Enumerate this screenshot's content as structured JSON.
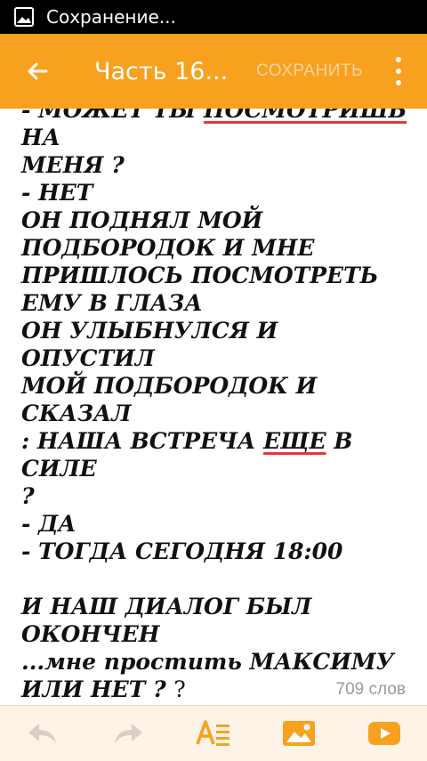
{
  "status_bar": {
    "text": "Сохранение...",
    "icon": "image-icon"
  },
  "app_bar": {
    "title": "Часть 16...",
    "save_label": "СОХРАНИТЬ",
    "back_icon": "arrow-left-icon",
    "menu_icon": "more-vertical-icon"
  },
  "editor": {
    "lines": [
      {
        "parts": [
          {
            "t": "- МОЖЕТ ТЫ "
          },
          {
            "t": "ПОСМОТРИШЬ",
            "err": true
          },
          {
            "t": " НА"
          }
        ]
      },
      {
        "parts": [
          {
            "t": "МЕНЯ ?"
          }
        ]
      },
      {
        "parts": [
          {
            "t": "- НЕТ"
          }
        ]
      },
      {
        "parts": [
          {
            "t": "ОН ПОДНЯЛ МОЙ"
          }
        ]
      },
      {
        "parts": [
          {
            "t": "ПОДБОРОДОК И МНЕ"
          }
        ]
      },
      {
        "parts": [
          {
            "t": "ПРИШЛОСЬ ПОСМОТРЕТЬ"
          }
        ]
      },
      {
        "parts": [
          {
            "t": "ЕМУ В ГЛАЗА"
          }
        ]
      },
      {
        "parts": [
          {
            "t": "ОН УЛЫБНУЛСЯ И ОПУСТИЛ"
          }
        ]
      },
      {
        "parts": [
          {
            "t": "МОЙ ПОДБОРОДОК И СКАЗАЛ"
          }
        ]
      },
      {
        "parts": [
          {
            "t": ": НАША ВСТРЕЧА "
          },
          {
            "t": "ЕЩЕ",
            "err": true
          },
          {
            "t": " В СИЛЕ"
          }
        ]
      },
      {
        "parts": [
          {
            "t": "?"
          }
        ]
      },
      {
        "parts": [
          {
            "t": "- ДА"
          }
        ]
      },
      {
        "parts": [
          {
            "t": "- ТОГДА СЕГОДНЯ 18:00"
          }
        ]
      },
      {
        "parts": [
          {
            "t": ""
          }
        ]
      },
      {
        "parts": [
          {
            "t": "И НАШ ДИАЛОГ БЫЛ"
          }
        ]
      },
      {
        "parts": [
          {
            "t": "ОКОНЧЕН"
          }
        ]
      },
      {
        "parts": [
          {
            "t": "...мне простить МАКСИМУ"
          }
        ]
      },
      {
        "parts": [
          {
            "t": "ИЛИ НЕТ ? "
          },
          {
            "t": "?",
            "plain": true
          }
        ]
      },
      {
        "parts": [
          {
            "t": ".",
            "plain": true
          }
        ]
      }
    ],
    "word_count": "709 слов"
  },
  "toolbar": {
    "items": [
      {
        "name": "undo-button",
        "icon": "undo-icon"
      },
      {
        "name": "redo-button",
        "icon": "redo-icon"
      },
      {
        "name": "text-format-button",
        "icon": "text-format-icon"
      },
      {
        "name": "insert-image-button",
        "icon": "image-icon"
      },
      {
        "name": "insert-video-button",
        "icon": "youtube-icon"
      }
    ],
    "accent": "#f7a11e",
    "disabled": "#d9cfc4"
  },
  "colors": {
    "app_bar": "#f7a11e",
    "status_bar": "#000000",
    "misspell": "#e53935"
  }
}
